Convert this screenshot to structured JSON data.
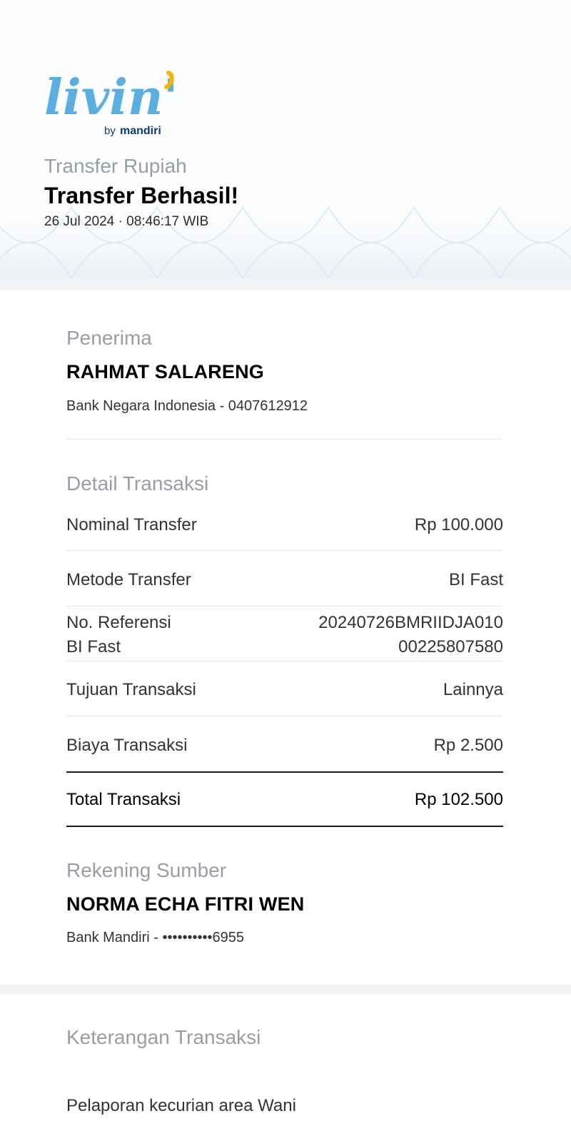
{
  "logo": {
    "brand": "livin'",
    "by": "by",
    "bank": "mandiri",
    "accent_color": "#f5b400",
    "brand_color": "#5aaee0",
    "bank_color": "#0a3a7a"
  },
  "header": {
    "subtitle": "Transfer Rupiah",
    "title": "Transfer Berhasil!",
    "datetime": "26 Jul 2024 · 08:46:17 WIB"
  },
  "recipient": {
    "label": "Penerima",
    "name": "RAHMAT SALARENG",
    "bank_account": "Bank Negara Indonesia - 0407612912"
  },
  "details": {
    "label": "Detail Transaksi",
    "rows": [
      {
        "label": "Nominal Transfer",
        "value": "Rp 100.000"
      },
      {
        "label": "Metode Transfer",
        "value": "BI Fast"
      },
      {
        "label_line1": "No. Referensi",
        "label_line2": "BI Fast",
        "value_line1": "20240726BMRIIDJA010",
        "value_line2": "00225807580"
      },
      {
        "label": "Tujuan Transaksi",
        "value": "Lainnya"
      },
      {
        "label": "Biaya Transaksi",
        "value": "Rp 2.500"
      }
    ],
    "total": {
      "label": "Total Transaksi",
      "value": "Rp 102.500"
    }
  },
  "source": {
    "label": "Rekening Sumber",
    "name": "NORMA ECHA FITRI WEN",
    "bank_account": "Bank Mandiri - ••••••••••6955"
  },
  "notes": {
    "label": "Keterangan Transaksi",
    "text": "Pelaporan kecurian area Wani"
  }
}
